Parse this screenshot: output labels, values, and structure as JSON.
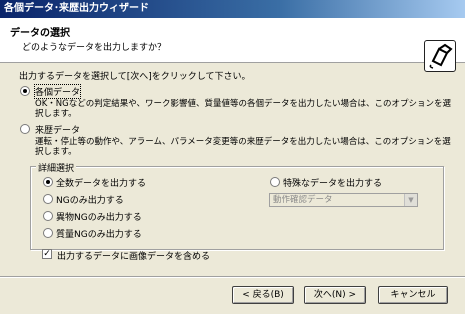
{
  "window": {
    "title": "各個データ･来歴出力ウィザード"
  },
  "header": {
    "title": "データの選択",
    "subtitle": "どのようなデータを出力しますか？",
    "icon": "wizard-export-icon"
  },
  "instruction": "出力するデータを選択して[次へ]をクリックして下さい。",
  "options": {
    "individual": {
      "label": "各個データ",
      "selected": true,
      "description": "OK・NGなどの判定結果や、ワーク影響値、質量値等の各個データを出力したい場合は、このオプションを選択します。"
    },
    "history": {
      "label": "来歴データ",
      "selected": false,
      "description": "運転・停止等の動作や、アラーム、パラメータ変更等の来歴データを出力したい場合は、このオプションを選択します。"
    }
  },
  "details": {
    "title": "詳細選択",
    "radios": [
      {
        "label": "全数データを出力する",
        "selected": true
      },
      {
        "label": "NGのみ出力する",
        "selected": false
      },
      {
        "label": "異物NGのみ出力する",
        "selected": false
      },
      {
        "label": "質量NGのみ出力する",
        "selected": false
      }
    ],
    "special": {
      "label": "特殊なデータを出力する",
      "selected": false
    },
    "select": {
      "value": "動作確認データ",
      "enabled": false
    }
  },
  "include_images": {
    "label": "出力するデータに画像データを含める",
    "checked": true
  },
  "buttons": {
    "back": "< 戻る(B)",
    "next": "次へ(N) >",
    "cancel": "キャンセル"
  }
}
